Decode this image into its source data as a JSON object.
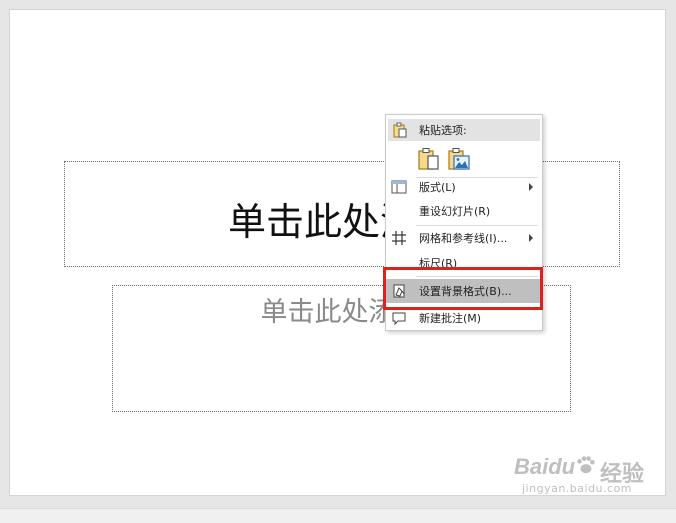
{
  "slide": {
    "title_placeholder": "单击此处添加",
    "subtitle_placeholder": "单击此处添加"
  },
  "context_menu": {
    "paste_header": "粘贴选项:",
    "items": [
      {
        "label": "版式(L)",
        "icon": "layout-icon",
        "submenu": true
      },
      {
        "label": "重设幻灯片(R)",
        "icon": "",
        "submenu": false
      },
      {
        "label": "网格和参考线(I)...",
        "icon": "grid-icon",
        "submenu": true
      },
      {
        "label": "标尺(R)",
        "icon": "",
        "submenu": false
      },
      {
        "label": "设置背景格式(B)...",
        "icon": "format-background-icon",
        "submenu": false,
        "highlighted": true
      },
      {
        "label": "新建批注(M)",
        "icon": "comment-icon",
        "submenu": false
      }
    ]
  },
  "watermark": {
    "logo": "Baidu",
    "brand": "经验",
    "url": "jingyan.baidu.com"
  },
  "colors": {
    "highlight_box": "#e02020",
    "menu_highlight": "#bfbfbf"
  }
}
